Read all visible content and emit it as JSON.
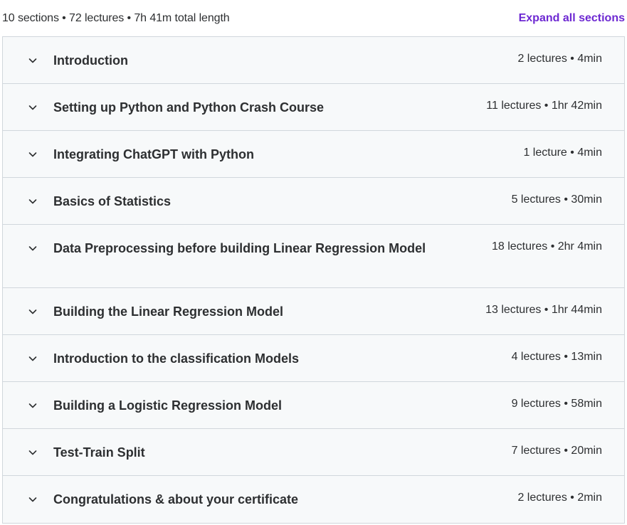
{
  "header": {
    "summary": "10 sections • 72 lectures • 7h 41m total length",
    "expand_label": "Expand all sections"
  },
  "icons": {
    "chevron": "chevron-down-icon"
  },
  "colors": {
    "accent": "#6d28d2",
    "section_bg": "#f7f9fa",
    "border": "#d1d7dc",
    "text": "#2d2f31"
  },
  "sections": [
    {
      "title": "Introduction",
      "meta": "2 lectures • 4min"
    },
    {
      "title": "Setting up Python and Python Crash Course",
      "meta": "11 lectures • 1hr 42min"
    },
    {
      "title": "Integrating ChatGPT with Python",
      "meta": "1 lecture • 4min"
    },
    {
      "title": "Basics of Statistics",
      "meta": "5 lectures • 30min"
    },
    {
      "title": "Data Preprocessing before building Linear Regression Model",
      "meta": "18 lectures • 2hr 4min"
    },
    {
      "title": "Building the Linear Regression Model",
      "meta": "13 lectures • 1hr 44min"
    },
    {
      "title": "Introduction to the classification Models",
      "meta": "4 lectures • 13min"
    },
    {
      "title": "Building a Logistic Regression Model",
      "meta": "9 lectures • 58min"
    },
    {
      "title": "Test-Train Split",
      "meta": "7 lectures • 20min"
    },
    {
      "title": "Congratulations & about your certificate",
      "meta": "2 lectures • 2min"
    }
  ]
}
